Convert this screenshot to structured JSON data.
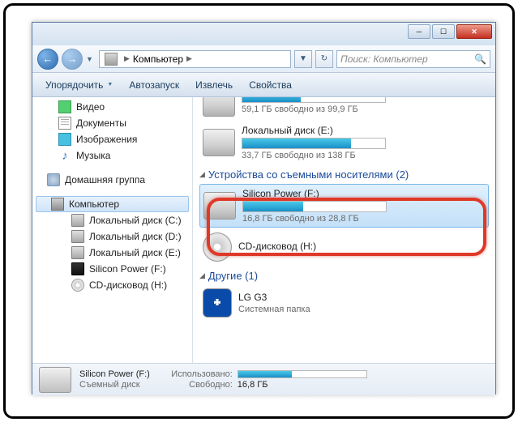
{
  "titlebar": {},
  "nav": {
    "location": "Компьютер",
    "search_placeholder": "Поиск: Компьютер"
  },
  "toolbar": {
    "organize": "Упорядочить",
    "autorun": "Автозапуск",
    "eject": "Извлечь",
    "properties": "Свойства"
  },
  "sidebar": {
    "video": "Видео",
    "documents": "Документы",
    "images": "Изображения",
    "music": "Музыка",
    "homegroup": "Домашняя группа",
    "computer": "Компьютер",
    "disks": [
      "Локальный диск (C:)",
      "Локальный диск (D:)",
      "Локальный диск (E:)",
      "Silicon Power (F:)",
      "CD-дисковод (H:)"
    ]
  },
  "content": {
    "disk_d": {
      "free": "59,1 ГБ свободно из 99,9 ГБ",
      "fill_pct": 41
    },
    "disk_e": {
      "name": "Локальный диск (E:)",
      "free": "33,7 ГБ свободно из 138 ГБ",
      "fill_pct": 76
    },
    "cat_removable": "Устройства со съемными носителями (2)",
    "usb": {
      "name": "Silicon Power (F:)",
      "free": "16,8 ГБ свободно из 28,8 ГБ",
      "fill_pct": 42
    },
    "cd": {
      "name": "CD-дисковод (H:)"
    },
    "cat_other": "Другие (1)",
    "bt": {
      "name": "LG G3",
      "sub": "Системная папка"
    }
  },
  "status": {
    "name": "Silicon Power (F:)",
    "type": "Съемный диск",
    "used_label": "Использовано:",
    "free_label": "Свободно:",
    "free_val": "16,8 ГБ",
    "fill_pct": 42
  },
  "chart_data": [
    {
      "type": "bar",
      "title": "Локальный диск (D:)",
      "categories": [
        "used",
        "free"
      ],
      "values": [
        40.8,
        59.1
      ],
      "ylim": [
        0,
        99.9
      ],
      "ylabel": "ГБ"
    },
    {
      "type": "bar",
      "title": "Локальный диск (E:)",
      "categories": [
        "used",
        "free"
      ],
      "values": [
        104.3,
        33.7
      ],
      "ylim": [
        0,
        138
      ],
      "ylabel": "ГБ"
    },
    {
      "type": "bar",
      "title": "Silicon Power (F:)",
      "categories": [
        "used",
        "free"
      ],
      "values": [
        12.0,
        16.8
      ],
      "ylim": [
        0,
        28.8
      ],
      "ylabel": "ГБ"
    }
  ]
}
